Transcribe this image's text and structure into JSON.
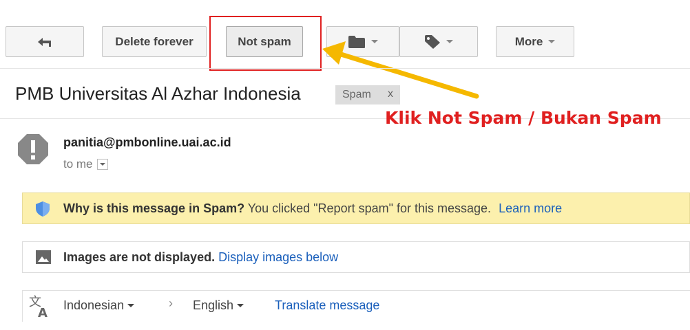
{
  "toolbar": {
    "back_icon": "arrow-left-icon",
    "delete_forever": "Delete forever",
    "not_spam": "Not spam",
    "move_icon": "folder-icon",
    "labels_icon": "tag-icon",
    "more": "More"
  },
  "subject": {
    "title": "PMB Universitas Al Azhar Indonesia",
    "label": "Spam",
    "label_remove": "x"
  },
  "annotation": {
    "text": "Klik Not Spam / Bukan Spam",
    "color": "#e02020",
    "arrow_color": "#f5b800"
  },
  "message": {
    "sender": "panitia@pmbonline.uai.ac.id",
    "recipient": "to me"
  },
  "spam_notice": {
    "heading": "Why is this message in Spam?",
    "body": "You clicked \"Report spam\" for this message.",
    "link": "Learn more"
  },
  "images_notice": {
    "heading": "Images are not displayed.",
    "link": "Display images below"
  },
  "translate": {
    "source_lang": "Indonesian",
    "target_lang": "English",
    "link": "Translate message"
  }
}
